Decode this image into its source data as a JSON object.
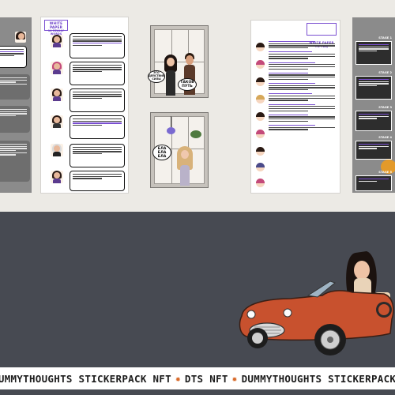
{
  "board": {
    "white_paper_title": "WHITE PAPER",
    "white_paper_subtitle": "14 REALLY WORDS",
    "faq_title": "WHITE PAPER\nTO FAQ",
    "room1_bubble_left": "ЭТО ДЕЙСТВИЕ СИЛЫ",
    "room1_bubble_right": "ТАКОВ ПУТЬ",
    "room2_bubble": "БЛА БЛА БЛА",
    "stages": [
      "STAGE 1",
      "STAGE 2",
      "STAGE 3",
      "STAGE 4",
      "STAGE 5"
    ]
  },
  "ticker": {
    "items": [
      "DUMMYTHOUGHTS STICKERPACK NFT",
      "DTS NFT",
      "DUMMYTHOUGHTS STICKERPACK NFT"
    ],
    "prefix": "OUMMYTHOUGHTS STICKERPACK NFT",
    "separator": "✹"
  },
  "colors": {
    "accent": "#7a4fd1",
    "car": "#c8512e",
    "ticker_sep": "#d86a2a",
    "bottom_bg": "#474a52"
  }
}
